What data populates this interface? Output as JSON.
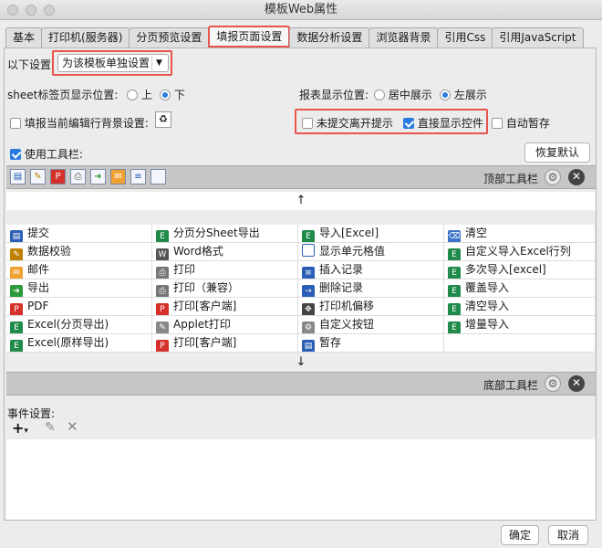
{
  "window": {
    "title": "模板Web属性"
  },
  "tabs": [
    "基本",
    "打印机(服务器)",
    "分页预览设置",
    "填报页面设置",
    "数据分析设置",
    "浏览器背景",
    "引用Css",
    "引用JavaScript"
  ],
  "active_tab": "填报页面设置",
  "settings": {
    "scope_label": "以下设置:",
    "scope_value": "为该模板单独设置",
    "sheet_pos_label": "sheet标签页显示位置:",
    "sheet_pos_options": [
      "上",
      "下"
    ],
    "sheet_pos_selected": "下",
    "report_pos_label": "报表显示位置:",
    "report_pos_options": [
      "居中展示",
      "左展示"
    ],
    "report_pos_selected": "左展示",
    "row_bg_label": "填报当前编辑行背景设置:",
    "unsubmitted_warn": "未提交离开提示",
    "show_controls": "直接显示控件",
    "auto_save": "自动暂存",
    "use_toolbar": "使用工具栏:",
    "restore_default": "恢复默认"
  },
  "top_toolbar": {
    "label": "顶部工具栏",
    "icons": [
      "save-icon",
      "validate-icon",
      "pdf-icon",
      "print-icon",
      "export-icon",
      "mail-icon",
      "insert-row-icon",
      "cell-icon"
    ]
  },
  "bottom_toolbar": {
    "label": "底部工具栏"
  },
  "toolbar_items": [
    [
      "提交",
      "分页分Sheet导出",
      "导入[Excel]",
      "清空"
    ],
    [
      "数据校验",
      "Word格式",
      "显示单元格值",
      "自定义导入Excel行列"
    ],
    [
      "邮件",
      "打印",
      "插入记录",
      "多次导入[excel]"
    ],
    [
      "导出",
      "打印（兼容）",
      "删除记录",
      "覆盖导入"
    ],
    [
      "PDF",
      "打印[客户端]",
      "打印机偏移",
      "清空导入"
    ],
    [
      "Excel(分页导出)",
      "Applet打印",
      "自定义按钮",
      "增量导入"
    ],
    [
      "Excel(原样导出)",
      "打印[客户端]",
      "暂存",
      ""
    ]
  ],
  "item_icons": [
    [
      "save-icon",
      "excel-icon",
      "excel-icon",
      "eraser-icon"
    ],
    [
      "validate-icon",
      "word-icon",
      "cell-icon",
      "excel-icon"
    ],
    [
      "mail-icon",
      "print-icon",
      "insert-row-icon",
      "excel-icon"
    ],
    [
      "export-icon",
      "print-icon",
      "delete-row-icon",
      "excel-icon"
    ],
    [
      "pdf-icon",
      "pdf-icon",
      "move-icon",
      "excel-icon"
    ],
    [
      "excel-icon",
      "applet-icon",
      "gear-icon",
      "excel-icon"
    ],
    [
      "excel-icon",
      "pdf-icon",
      "save-icon",
      ""
    ]
  ],
  "events": {
    "label": "事件设置:"
  },
  "footer": {
    "ok": "确定",
    "cancel": "取消"
  }
}
